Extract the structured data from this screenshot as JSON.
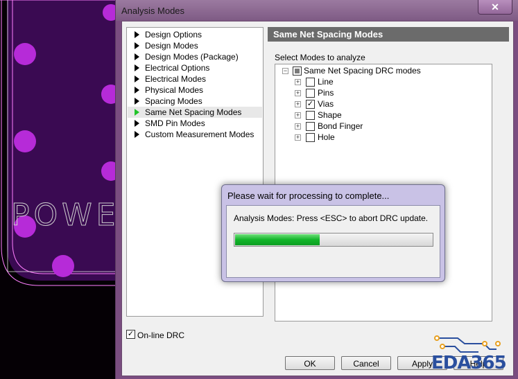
{
  "window": {
    "title": "Analysis Modes",
    "close_glyph": "✕"
  },
  "background": {
    "silkscreen_text": "POWER F"
  },
  "tree": {
    "items": [
      {
        "label": "Design Options",
        "selected": false
      },
      {
        "label": "Design Modes",
        "selected": false
      },
      {
        "label": "Design Modes (Package)",
        "selected": false
      },
      {
        "label": "Electrical Options",
        "selected": false
      },
      {
        "label": "Electrical Modes",
        "selected": false
      },
      {
        "label": "Physical Modes",
        "selected": false
      },
      {
        "label": "Spacing Modes",
        "selected": false
      },
      {
        "label": "Same Net Spacing Modes",
        "selected": true
      },
      {
        "label": "SMD Pin Modes",
        "selected": false
      },
      {
        "label": "Custom Measurement Modes",
        "selected": false
      }
    ]
  },
  "panel": {
    "header": "Same Net Spacing Modes",
    "select_label": "Select Modes to analyze",
    "root": {
      "label": "Same Net Spacing DRC modes",
      "state": "partial",
      "expander": "−"
    },
    "modes": [
      {
        "label": "Line",
        "checked": false,
        "expander": "+"
      },
      {
        "label": "Pins",
        "checked": false,
        "expander": "+"
      },
      {
        "label": "Vias",
        "checked": true,
        "expander": "+"
      },
      {
        "label": "Shape",
        "checked": false,
        "expander": "+"
      },
      {
        "label": "Bond Finger",
        "checked": false,
        "expander": "+"
      },
      {
        "label": "Hole",
        "checked": false,
        "expander": "+"
      }
    ],
    "check_glyph": "✓"
  },
  "online_drc": {
    "label": "On-line DRC",
    "checked": true
  },
  "buttons": {
    "ok": "OK",
    "cancel": "Cancel",
    "apply": "Apply",
    "help": "Help"
  },
  "progress_dialog": {
    "title": "Please wait for processing to complete...",
    "message": "Analysis Modes: Press <ESC> to abort DRC update.",
    "progress_fraction": 0.43
  },
  "watermark": {
    "text": "EDA365"
  },
  "colors": {
    "selected_arrow": "#22c42a",
    "progress_fill": "#12b52a",
    "pcb_fill": "#3a0a52",
    "pad": "#b62bd8",
    "logo": "#2a4f9e",
    "logo_accent": "#e8a020"
  }
}
